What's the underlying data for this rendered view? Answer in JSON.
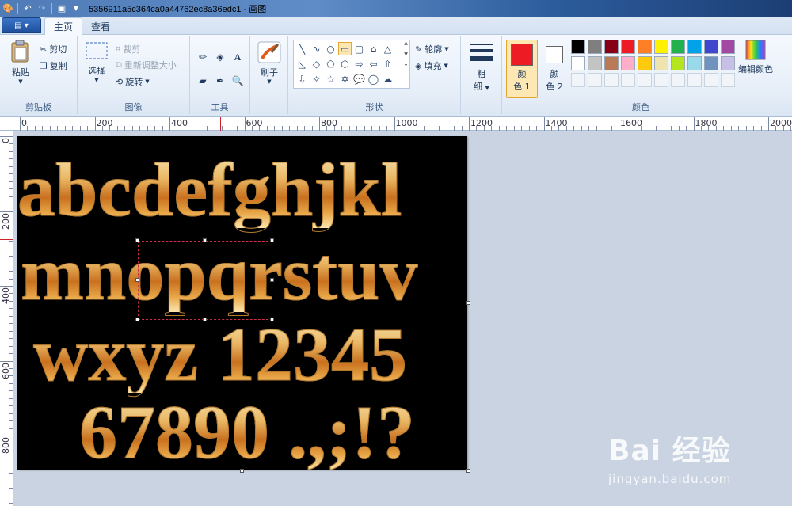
{
  "window": {
    "title": "5356911a5c364ca0a44762ec8a36edc1 - 画图"
  },
  "tabs": [
    "主页",
    "查看"
  ],
  "ribbon": {
    "clipboard": {
      "label": "剪贴板",
      "paste": "粘贴",
      "cut": "剪切",
      "copy": "复制"
    },
    "image": {
      "label": "图像",
      "select": "选择",
      "crop": "裁剪",
      "resize": "重新调整大小",
      "rotate": "旋转"
    },
    "tools": {
      "label": "工具"
    },
    "brushes": {
      "label": "刷子"
    },
    "shapes": {
      "label": "形状",
      "outline": "轮廓",
      "fill": "填充"
    },
    "size": {
      "label_line1": "粗",
      "label_line2": "细"
    },
    "colors": {
      "label": "颜色",
      "color1_line1": "颜",
      "color1_line2": "色 1",
      "color2_line1": "颜",
      "color2_line2": "色 2",
      "edit": "编辑颜色",
      "active_color1": "#ed1c24",
      "active_color2": "#ffffff",
      "row1": [
        "#000000",
        "#7f7f7f",
        "#880015",
        "#ed1c24",
        "#ff7f27",
        "#fff200",
        "#22b14c",
        "#00a2e8",
        "#3f48cc",
        "#a349a4"
      ],
      "row2": [
        "#ffffff",
        "#c3c3c3",
        "#b97a57",
        "#ffaec9",
        "#ffc90e",
        "#efe4b0",
        "#b5e61d",
        "#99d9ea",
        "#7092be",
        "#c8bfe7"
      ]
    }
  },
  "ruler": {
    "h_labels": [
      "0",
      "200",
      "400",
      "600",
      "800",
      "1000",
      "1200",
      "1400",
      "1600",
      "1800",
      "2000"
    ],
    "v_labels": [
      "0",
      "200",
      "400",
      "600",
      "800"
    ]
  },
  "canvas": {
    "lines": [
      "abcdefghjkl",
      "mnopqrstuv",
      "wxyz 12345",
      "67890 .,;!?"
    ]
  },
  "watermark": {
    "brand": "Bai 经验",
    "url": "jingyan.baidu.com"
  }
}
